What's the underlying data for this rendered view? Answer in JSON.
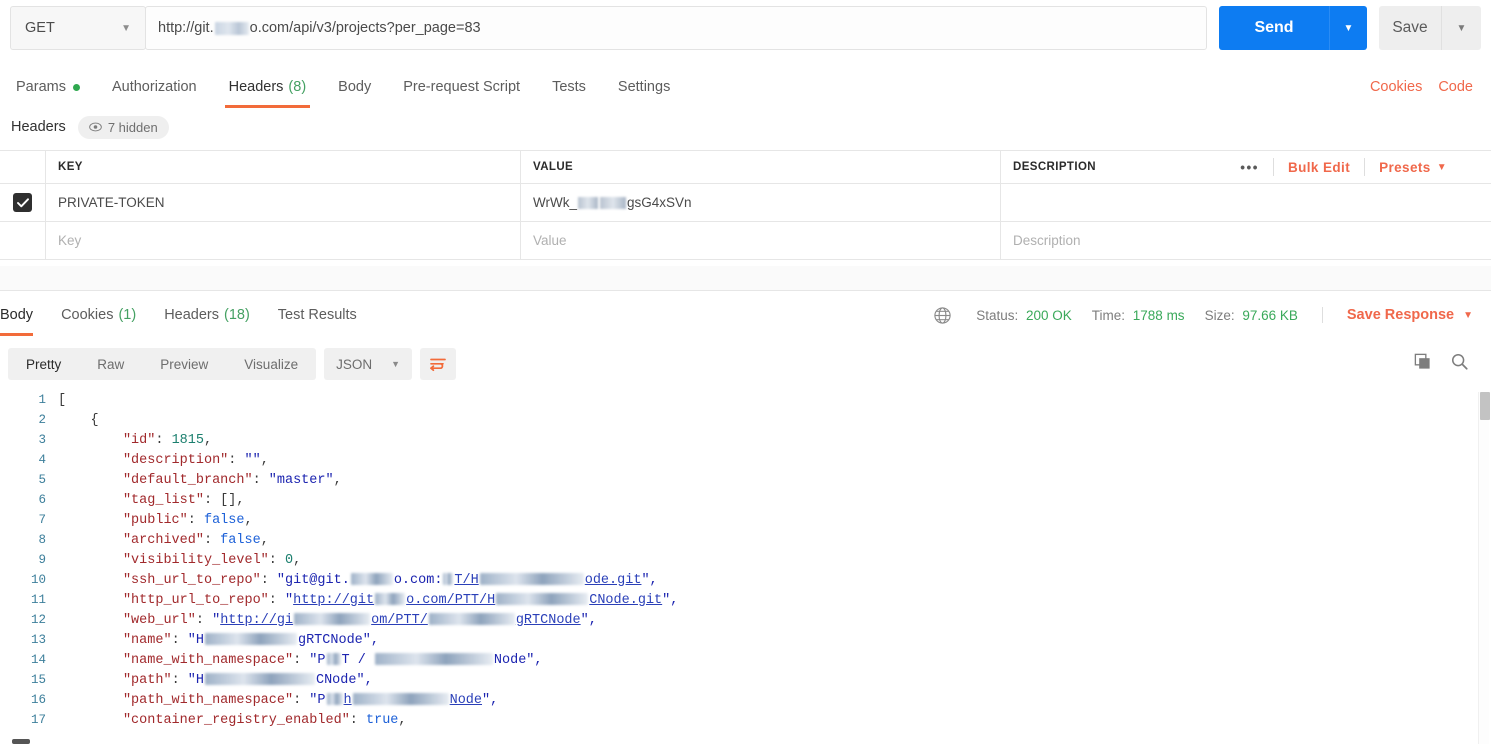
{
  "request": {
    "method": "GET",
    "url_prefix": "http://git.",
    "url_suffix": "o.com/api/v3/projects?per_page=83",
    "send_label": "Send",
    "save_label": "Save",
    "tabs": [
      {
        "label": "Params",
        "count": "",
        "dot": true,
        "active": false
      },
      {
        "label": "Authorization",
        "count": "",
        "dot": false,
        "active": false
      },
      {
        "label": "Headers",
        "count": "(8)",
        "dot": false,
        "active": true
      },
      {
        "label": "Body",
        "count": "",
        "dot": false,
        "active": false
      },
      {
        "label": "Pre-request Script",
        "count": "",
        "dot": false,
        "active": false
      },
      {
        "label": "Tests",
        "count": "",
        "dot": false,
        "active": false
      },
      {
        "label": "Settings",
        "count": "",
        "dot": false,
        "active": false
      }
    ],
    "cookies_link": "Cookies",
    "code_link": "Code"
  },
  "headers_section": {
    "title": "Headers",
    "hidden_badge": "7 hidden",
    "columns": [
      "KEY",
      "VALUE",
      "DESCRIPTION"
    ],
    "actions": {
      "more": "•••",
      "bulk_edit": "Bulk Edit",
      "presets": "Presets"
    },
    "rows": [
      {
        "checked": true,
        "key": "PRIVATE-TOKEN",
        "value_prefix": "WrWk_",
        "value_suffix": "gsG4xSVn",
        "description": ""
      }
    ],
    "placeholders": {
      "key": "Key",
      "value": "Value",
      "description": "Description"
    }
  },
  "response": {
    "tabs": [
      {
        "label": "Body",
        "count": "",
        "active": true
      },
      {
        "label": "Cookies",
        "count": "(1)",
        "active": false
      },
      {
        "label": "Headers",
        "count": "(18)",
        "active": false
      },
      {
        "label": "Test Results",
        "count": "",
        "active": false
      }
    ],
    "status_label": "Status:",
    "status_value": "200 OK",
    "time_label": "Time:",
    "time_value": "1788 ms",
    "size_label": "Size:",
    "size_value": "97.66 KB",
    "save_response": "Save Response",
    "view_modes": [
      {
        "label": "Pretty",
        "active": true
      },
      {
        "label": "Raw",
        "active": false
      },
      {
        "label": "Preview",
        "active": false
      },
      {
        "label": "Visualize",
        "active": false
      }
    ],
    "format": "JSON"
  },
  "code": {
    "lines": [
      {
        "n": "1",
        "indent": 0,
        "parts": [
          {
            "t": "punc",
            "v": "["
          }
        ]
      },
      {
        "n": "2",
        "indent": 4,
        "parts": [
          {
            "t": "punc",
            "v": "{"
          }
        ]
      },
      {
        "n": "3",
        "indent": 8,
        "parts": [
          {
            "t": "key",
            "v": "\"id\""
          },
          {
            "t": "punc",
            "v": ": "
          },
          {
            "t": "num",
            "v": "1815"
          },
          {
            "t": "punc",
            "v": ","
          }
        ]
      },
      {
        "n": "4",
        "indent": 8,
        "parts": [
          {
            "t": "key",
            "v": "\"description\""
          },
          {
            "t": "punc",
            "v": ": "
          },
          {
            "t": "str",
            "v": "\"\""
          },
          {
            "t": "punc",
            "v": ","
          }
        ]
      },
      {
        "n": "5",
        "indent": 8,
        "parts": [
          {
            "t": "key",
            "v": "\"default_branch\""
          },
          {
            "t": "punc",
            "v": ": "
          },
          {
            "t": "str",
            "v": "\"master\""
          },
          {
            "t": "punc",
            "v": ","
          }
        ]
      },
      {
        "n": "6",
        "indent": 8,
        "parts": [
          {
            "t": "key",
            "v": "\"tag_list\""
          },
          {
            "t": "punc",
            "v": ": "
          },
          {
            "t": "punc",
            "v": "[],"
          }
        ]
      },
      {
        "n": "7",
        "indent": 8,
        "parts": [
          {
            "t": "key",
            "v": "\"public\""
          },
          {
            "t": "punc",
            "v": ": "
          },
          {
            "t": "bool",
            "v": "false"
          },
          {
            "t": "punc",
            "v": ","
          }
        ]
      },
      {
        "n": "8",
        "indent": 8,
        "parts": [
          {
            "t": "key",
            "v": "\"archived\""
          },
          {
            "t": "punc",
            "v": ": "
          },
          {
            "t": "bool",
            "v": "false"
          },
          {
            "t": "punc",
            "v": ","
          }
        ]
      },
      {
        "n": "9",
        "indent": 8,
        "parts": [
          {
            "t": "key",
            "v": "\"visibility_level\""
          },
          {
            "t": "punc",
            "v": ": "
          },
          {
            "t": "num",
            "v": "0"
          },
          {
            "t": "punc",
            "v": ","
          }
        ]
      },
      {
        "n": "10",
        "indent": 8,
        "parts": [
          {
            "t": "key",
            "v": "\"ssh_url_to_repo\""
          },
          {
            "t": "punc",
            "v": ": "
          },
          {
            "t": "str",
            "v": "\"git@git."
          },
          {
            "t": "blur",
            "v": "42"
          },
          {
            "t": "str",
            "v": "o.com:"
          },
          {
            "t": "blur",
            "v": "10"
          },
          {
            "t": "link",
            "v": "T/H"
          },
          {
            "t": "blur",
            "v": "104"
          },
          {
            "t": "link",
            "v": "ode.git"
          },
          {
            "t": "str",
            "v": "\","
          }
        ]
      },
      {
        "n": "11",
        "indent": 8,
        "parts": [
          {
            "t": "key",
            "v": "\"http_url_to_repo\""
          },
          {
            "t": "punc",
            "v": ": "
          },
          {
            "t": "str",
            "v": "\""
          },
          {
            "t": "link",
            "v": "http://git"
          },
          {
            "t": "blur",
            "v": "30"
          },
          {
            "t": "link",
            "v": "o.com/PTT/H"
          },
          {
            "t": "blur",
            "v": "92"
          },
          {
            "t": "link",
            "v": "CNode.git"
          },
          {
            "t": "str",
            "v": "\","
          }
        ]
      },
      {
        "n": "12",
        "indent": 8,
        "parts": [
          {
            "t": "key",
            "v": "\"web_url\""
          },
          {
            "t": "punc",
            "v": ": "
          },
          {
            "t": "str",
            "v": "\""
          },
          {
            "t": "link",
            "v": "http://gi"
          },
          {
            "t": "blur",
            "v": "76"
          },
          {
            "t": "link",
            "v": "om/PTT/"
          },
          {
            "t": "blur",
            "v": "86"
          },
          {
            "t": "link",
            "v": "gRTCNode"
          },
          {
            "t": "str",
            "v": "\","
          }
        ]
      },
      {
        "n": "13",
        "indent": 8,
        "parts": [
          {
            "t": "key",
            "v": "\"name\""
          },
          {
            "t": "punc",
            "v": ": "
          },
          {
            "t": "str",
            "v": "\"H"
          },
          {
            "t": "blur",
            "v": "92"
          },
          {
            "t": "str",
            "v": "gRTCNode\","
          }
        ]
      },
      {
        "n": "14",
        "indent": 8,
        "parts": [
          {
            "t": "key",
            "v": "\"name_with_namespace\""
          },
          {
            "t": "punc",
            "v": ": "
          },
          {
            "t": "str",
            "v": "\"P"
          },
          {
            "t": "blur",
            "v": "14"
          },
          {
            "t": "str",
            "v": "T / "
          },
          {
            "t": "blur",
            "v": "118"
          },
          {
            "t": "str",
            "v": "Node\","
          }
        ]
      },
      {
        "n": "15",
        "indent": 8,
        "parts": [
          {
            "t": "key",
            "v": "\"path\""
          },
          {
            "t": "punc",
            "v": ": "
          },
          {
            "t": "str",
            "v": "\"H"
          },
          {
            "t": "blur",
            "v": "110"
          },
          {
            "t": "str",
            "v": "CNode\","
          }
        ]
      },
      {
        "n": "16",
        "indent": 8,
        "parts": [
          {
            "t": "key",
            "v": "\"path_with_namespace\""
          },
          {
            "t": "punc",
            "v": ": "
          },
          {
            "t": "str",
            "v": "\"P"
          },
          {
            "t": "blur",
            "v": "16"
          },
          {
            "t": "link",
            "v": "h"
          },
          {
            "t": "blur",
            "v": "96"
          },
          {
            "t": "link",
            "v": "Node"
          },
          {
            "t": "str",
            "v": "\","
          }
        ]
      },
      {
        "n": "17",
        "indent": 8,
        "parts": [
          {
            "t": "key",
            "v": "\"container_registry_enabled\""
          },
          {
            "t": "punc",
            "v": ": "
          },
          {
            "t": "bool",
            "v": "true"
          },
          {
            "t": "punc",
            "v": ","
          }
        ]
      }
    ]
  },
  "icons": {
    "chevron_down": "chevron-down-icon",
    "eye": "eye-icon",
    "globe": "globe-icon",
    "copy": "copy-icon",
    "search": "search-icon",
    "wrap": "wrap-lines-icon",
    "check": "check-icon"
  },
  "colors": {
    "accent_orange": "#f26b3a",
    "send_blue": "#0d7cf2",
    "status_green": "#3aa95a",
    "link_orange": "#f0684b"
  }
}
